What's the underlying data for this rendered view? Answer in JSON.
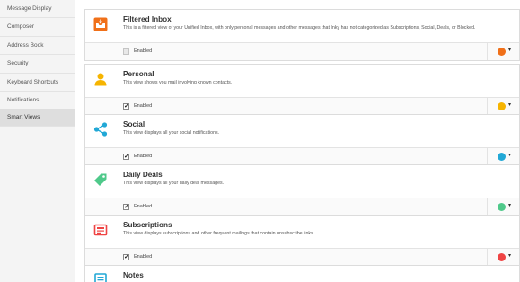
{
  "sidebar": {
    "items": [
      {
        "label": "Message Display"
      },
      {
        "label": "Composer"
      },
      {
        "label": "Address Book"
      },
      {
        "label": "Security"
      },
      {
        "label": "Keyboard Shortcuts"
      },
      {
        "label": "Notifications"
      },
      {
        "label": "Smart Views"
      }
    ]
  },
  "views": [
    {
      "title": "Filtered Inbox",
      "description": "This is a filtered view of your Unified Inbox, with only personal messages and other messages that Inky has not categorized as Subscriptions, Social, Deals, or Blocked.",
      "enabled_label": "Enabled",
      "checkbox": "",
      "color": "#f07019",
      "icon": "inbox-icon",
      "caret": "▾"
    },
    {
      "title": "Personal",
      "description": "This view shows you mail involving known contacts.",
      "enabled_label": "Enabled",
      "checkbox": "✓",
      "color": "#f6b400",
      "icon": "person-icon",
      "caret": "▾"
    },
    {
      "title": "Social",
      "description": "This view displays all your social notifications.",
      "enabled_label": "Enabled",
      "checkbox": "✓",
      "color": "#22a8d6",
      "icon": "share-icon",
      "caret": "▾"
    },
    {
      "title": "Daily Deals",
      "description": "This view displays all your daily deal messages.",
      "enabled_label": "Enabled",
      "checkbox": "✓",
      "color": "#4fc98a",
      "icon": "tag-icon",
      "caret": "▾"
    },
    {
      "title": "Subscriptions",
      "description": "This view displays subscriptions and other frequent mailings that contain unsubscribe links.",
      "enabled_label": "Enabled",
      "checkbox": "✓",
      "color": "#ef4444",
      "icon": "newspaper-icon",
      "caret": "▾"
    },
    {
      "title": "Notes",
      "icon": "notes-icon"
    }
  ]
}
